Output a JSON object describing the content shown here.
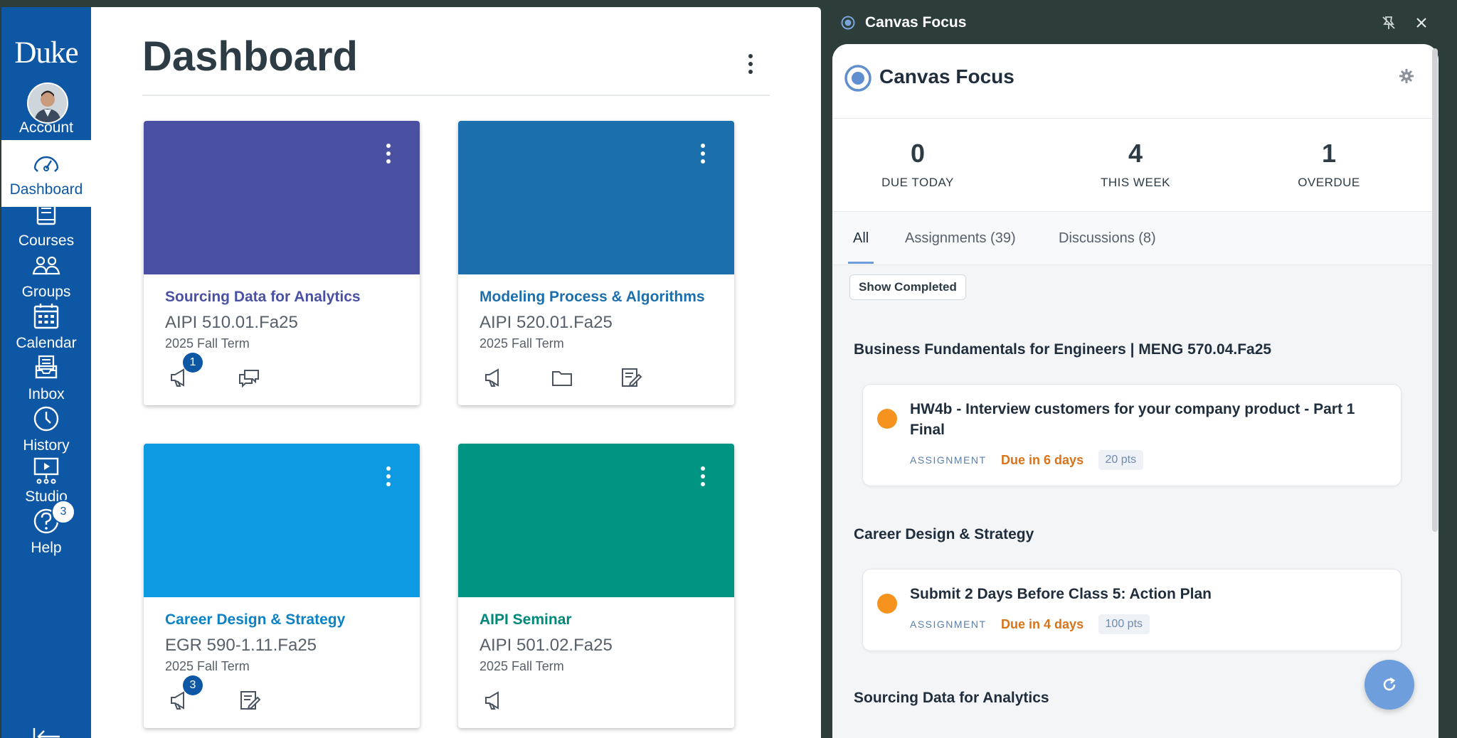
{
  "nav": {
    "logo": "Duke",
    "items": [
      {
        "label": "Account",
        "icon": "avatar"
      },
      {
        "label": "Dashboard",
        "icon": "dashboard-icon"
      },
      {
        "label": "Courses",
        "icon": "courses-icon"
      },
      {
        "label": "Groups",
        "icon": "groups-icon"
      },
      {
        "label": "Calendar",
        "icon": "calendar-icon"
      },
      {
        "label": "Inbox",
        "icon": "inbox-icon"
      },
      {
        "label": "History",
        "icon": "history-icon"
      },
      {
        "label": "Studio",
        "icon": "studio-icon"
      },
      {
        "label": "Help",
        "icon": "help-icon",
        "badge": "3"
      }
    ]
  },
  "dashboard": {
    "title": "Dashboard",
    "cards": [
      {
        "title": "Sourcing Data for Analytics",
        "code": "AIPI 510.01.Fa25",
        "term": "2025 Fall Term",
        "color": "#4a51a3",
        "title_color": "#4a51a3",
        "badge": "1"
      },
      {
        "title": "Modeling Process & Algorithms",
        "code": "AIPI 520.01.Fa25",
        "term": "2025 Fall Term",
        "color": "#1b6fad",
        "title_color": "#1b6fad"
      },
      {
        "title": "Career Design & Strategy",
        "code": "EGR 590-1.11.Fa25",
        "term": "2025 Fall Term",
        "color": "#0e9ae3",
        "title_color": "#0c82c4",
        "badge": "3"
      },
      {
        "title": "AIPI Seminar",
        "code": "AIPI 501.02.Fa25",
        "term": "2025 Fall Term",
        "color": "#009583",
        "title_color": "#00887a"
      }
    ]
  },
  "focus": {
    "window_title": "Canvas Focus",
    "panel_title": "Canvas Focus",
    "stats": [
      {
        "num": "0",
        "label": "DUE TODAY"
      },
      {
        "num": "4",
        "label": "THIS WEEK"
      },
      {
        "num": "1",
        "label": "OVERDUE"
      }
    ],
    "tabs": [
      "All",
      "Assignments (39)",
      "Discussions (8)"
    ],
    "show_completed": "Show Completed",
    "groups": [
      {
        "title": "Business Fundamentals for Engineers | MENG 570.04.Fa25"
      },
      {
        "title": "Career Design & Strategy"
      },
      {
        "title": "Sourcing Data for Analytics"
      }
    ],
    "items": [
      {
        "title": "HW4b - Interview customers for your company product - Part 1 Final",
        "type": "ASSIGNMENT",
        "due": "Due in 6 days",
        "pts": "20 pts"
      },
      {
        "title": "Submit 2 Days Before Class 5: Action Plan",
        "type": "ASSIGNMENT",
        "due": "Due in 4 days",
        "pts": "100 pts"
      }
    ]
  }
}
